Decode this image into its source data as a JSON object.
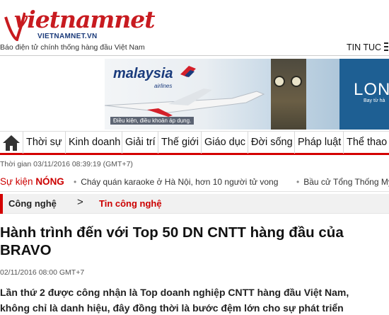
{
  "header": {
    "logo_text_v": "v",
    "logo_text_rest": "ietnamnet",
    "logo_sub": "VIETNAMNET.VN",
    "tagline": "Báo điện tử chính thống hàng đầu Việt Nam",
    "menu_label": "TIN TUC",
    "menu_icon": "hamburger-icon"
  },
  "banner": {
    "brand": "malaysia",
    "brand_sub": "airlines",
    "caption": "Điều kiện, điều khoản áp dụng.",
    "headline_partial": "LON",
    "sub_partial": "Bay từ hà"
  },
  "nav": {
    "home_icon": "home-icon",
    "items": [
      {
        "label": "Thời sự"
      },
      {
        "label": "Kinh doanh"
      },
      {
        "label": "Giải trí"
      },
      {
        "label": "Thế giới"
      },
      {
        "label": "Giáo dục"
      },
      {
        "label": "Đời sống"
      },
      {
        "label": "Pháp luật"
      },
      {
        "label": "Thể thao"
      }
    ],
    "accent": "#d40000"
  },
  "meta": {
    "time": "Thời gian 03/11/2016 08:39:19 (GMT+7)"
  },
  "hot": {
    "label_prefix": "Sự kiện ",
    "label_bold": "NÓNG",
    "items": [
      {
        "text": "Cháy quán karaoke ở Hà Nội, hơn 10 người tử vong"
      },
      {
        "text": "Bầu cử Tổng Thống Mỹ"
      }
    ]
  },
  "breadcrumb": {
    "section": "Công nghệ",
    "separator": ">",
    "subsection": "Tin công nghệ"
  },
  "article": {
    "title": "Hành trình đến với Top 50 DN CNTT hàng đầu của BRAVO",
    "date": "02/11/2016  08:00 GMT+7",
    "lead_line1": "Lần thứ 2 được công nhận là Top doanh nghiệp CNTT hàng đầu Việt Nam,",
    "lead_line2": "không chỉ là danh hiệu, đây đồng thời là bước đệm lớn cho sự phát triển"
  }
}
